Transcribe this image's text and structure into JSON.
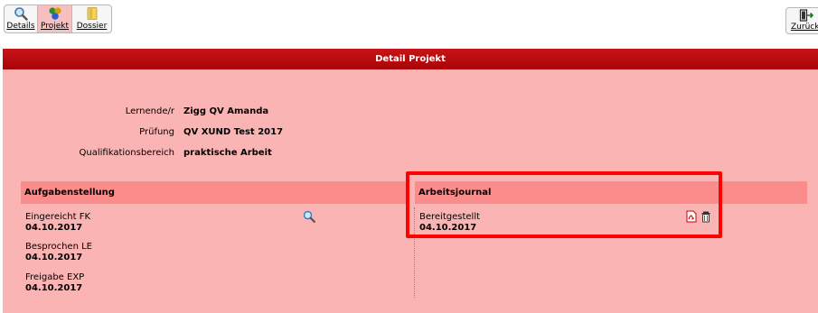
{
  "toolbar": {
    "tabs": [
      {
        "label": "Details",
        "icon": "magnifier-icon"
      },
      {
        "label": "Projekt",
        "icon": "project-icon",
        "active": true
      },
      {
        "label": "Dossier",
        "icon": "folder-icon"
      }
    ],
    "back_label": "Zurück"
  },
  "panel": {
    "title": "Detail Projekt",
    "fields": [
      {
        "key": "Lernende/r",
        "value": "Zigg QV Amanda"
      },
      {
        "key": "Prüfung",
        "value": "QV XUND Test 2017"
      },
      {
        "key": "Qualifikationsbereich",
        "value": "praktische Arbeit"
      }
    ],
    "aufgabenstellung": {
      "title": "Aufgabenstellung",
      "items": [
        {
          "label": "Eingereicht FK",
          "date": "04.10.2017"
        },
        {
          "label": "Besprochen LE",
          "date": "04.10.2017"
        },
        {
          "label": "Freigabe EXP",
          "date": "04.10.2017"
        }
      ]
    },
    "arbeitsjournal": {
      "title": "Arbeitsjournal",
      "items": [
        {
          "label": "Bereitgestellt",
          "date": "04.10.2017"
        }
      ]
    }
  },
  "colors": {
    "header": "#b00a0e",
    "panel_bg": "#fbb4b4",
    "section_bg": "#fa8c8c",
    "highlight": "#ff0000",
    "active_tab": "#f6c0c0"
  }
}
